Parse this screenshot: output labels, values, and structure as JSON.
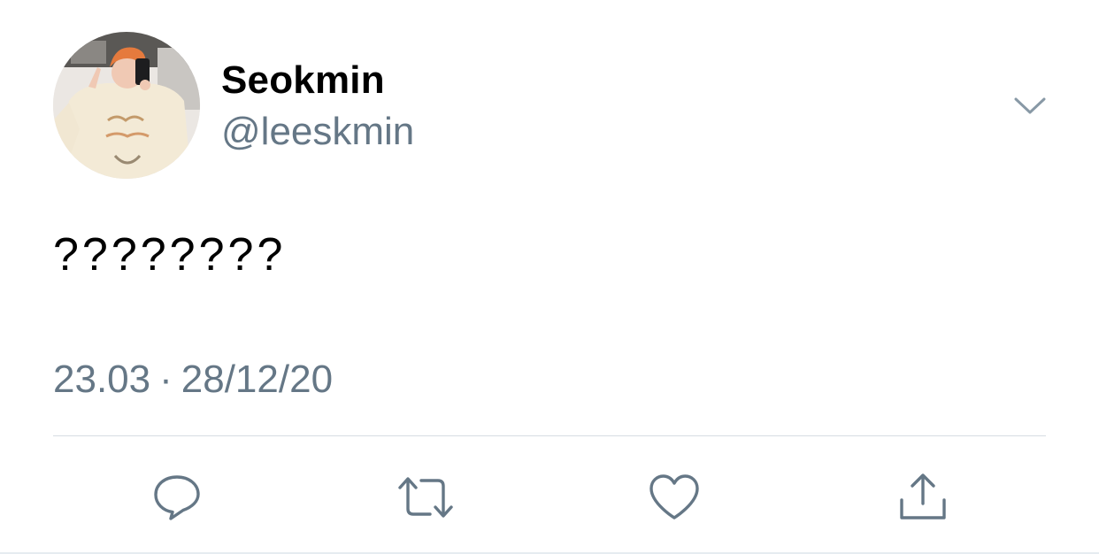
{
  "tweet": {
    "author": {
      "display_name": "Seokmin",
      "handle": "@leeskmin",
      "avatar": "profile-photo"
    },
    "text": "????????",
    "time": "23.03",
    "separator": "·",
    "date": "28/12/20"
  },
  "actions": [
    {
      "name": "reply",
      "icon": "reply-icon"
    },
    {
      "name": "retweet",
      "icon": "retweet-icon"
    },
    {
      "name": "like",
      "icon": "heart-icon"
    },
    {
      "name": "share",
      "icon": "share-icon"
    }
  ],
  "colors": {
    "text_primary": "#000000",
    "text_secondary": "#657786",
    "icon": "#657786",
    "divider": "#d6dde3",
    "background": "#ffffff"
  }
}
